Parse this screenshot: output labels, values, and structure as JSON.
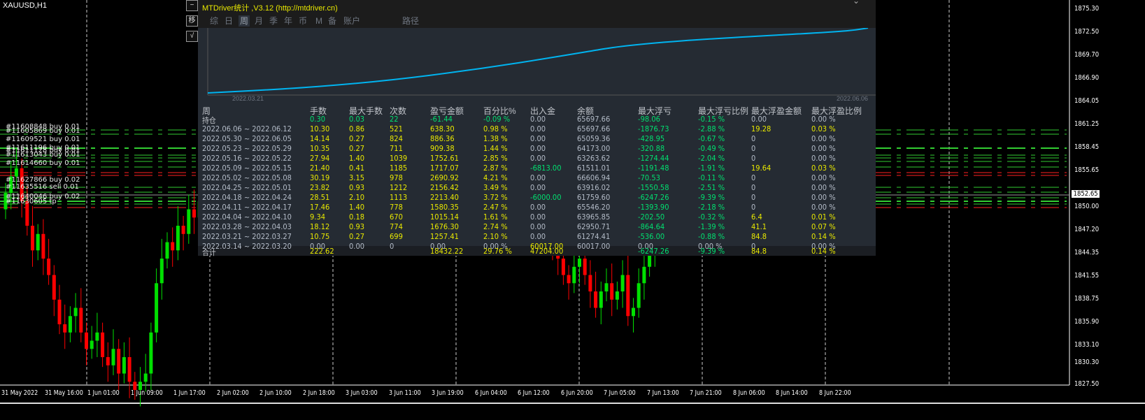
{
  "chart": {
    "symbol": "XAUUSD,H1",
    "current_price": "1852.65",
    "price_labels": [
      "1875.30",
      "1872.50",
      "1869.70",
      "1866.90",
      "1864.05",
      "1861.25",
      "1858.45",
      "1855.65",
      "1850.00",
      "1847.20",
      "1844.35",
      "1841.55",
      "1838.75",
      "1835.90",
      "1833.10",
      "1830.30",
      "1827.50"
    ],
    "time_labels": [
      "31 May 2022",
      "31 May 16:00",
      "1 Jun 01:00",
      "1 Jun 09:00",
      "1 Jun 17:00",
      "2 Jun 02:00",
      "2 Jun 10:00",
      "2 Jun 18:00",
      "3 Jun 03:00",
      "3 Jun 11:00",
      "3 Jun 19:00",
      "6 Jun 04:00",
      "6 Jun 12:00",
      "6 Jun 20:00",
      "7 Jun 05:00",
      "7 Jun 13:00",
      "7 Jun 21:00",
      "8 Jun 06:00",
      "8 Jun 14:00",
      "8 Jun 22:00"
    ],
    "order_labels": [
      "#11608848 buy 0.01",
      "#11605869 buy 0.01",
      "#11609521 buy 0.01",
      "#11611196 buy 0.01",
      "#11611128 buy 0.01",
      "#11613043 buy 0.01",
      "#11614660 buy 0.01",
      "#11627866 buy 0.02",
      "#11635516 sell 0.01",
      "#11640046 buy 0.02",
      "#11630605 tp"
    ],
    "candles_left": [
      1853,
      1855,
      1856,
      1852,
      1849,
      1846,
      1848,
      1845,
      1843,
      1840,
      1837,
      1836,
      1838,
      1839,
      1836,
      1834,
      1835,
      1836,
      1833,
      1832,
      1834,
      1831,
      1833,
      1830,
      1829,
      1830,
      1831,
      1836,
      1842,
      1845,
      1847,
      1846,
      1849,
      1848,
      1851,
      1850,
      1852
    ],
    "candles_mid": [
      1846,
      1845,
      1843,
      1842,
      1844,
      1845,
      1843,
      1841,
      1839,
      1841,
      1842,
      1840,
      1841,
      1843,
      1838,
      1839,
      1842,
      1844,
      1846,
      1848,
      1847
    ],
    "colors": {
      "up": "#00e000",
      "down": "#ff0000",
      "order_buy": "#32cd32",
      "order_sl": "#ff2020"
    }
  },
  "side_buttons": [
    "−",
    "移",
    "√"
  ],
  "panel": {
    "title": "MTDriver统计 ,V3.12 (http://mtdriver.cn)",
    "tabs": [
      "综",
      "日",
      "周",
      "月",
      "季",
      "年",
      "币",
      "M",
      "备",
      "账户",
      "路径"
    ],
    "active_tab": 2,
    "equity_start_date": "2022.03.21",
    "equity_end_date": "2022.06.06",
    "accent": "#00b4f0",
    "headers": [
      "周",
      "手数",
      "最大手数",
      "次数",
      "盈亏金额",
      "百分比%",
      "出入金",
      "余额",
      "最大浮亏",
      "最大浮亏比例",
      "最大浮盈金额",
      "最大浮盈比例"
    ],
    "position_row": [
      "持仓",
      "0.30",
      "0.03",
      "22",
      "-61.44",
      "-0.09 %",
      "0.00",
      "65697.66",
      "-98.06",
      "-0.15 %",
      "0.00",
      "0.00 %"
    ],
    "rows": [
      [
        "2022.06.06 ~ 2022.06.12",
        "10.30",
        "0.86",
        "521",
        "638.30",
        "0.98 %",
        "0.00",
        "65697.66",
        "-1876.73",
        "-2.88 %",
        "19.28",
        "0.03 %"
      ],
      [
        "2022.05.30 ~ 2022.06.05",
        "14.14",
        "0.27",
        "824",
        "886.36",
        "1.38 %",
        "0.00",
        "65059.36",
        "-428.95",
        "-0.67 %",
        "0",
        "0.00 %"
      ],
      [
        "2022.05.23 ~ 2022.05.29",
        "10.35",
        "0.27",
        "711",
        "909.38",
        "1.44 %",
        "0.00",
        "64173.00",
        "-320.88",
        "-0.49 %",
        "0",
        "0.00 %"
      ],
      [
        "2022.05.16 ~ 2022.05.22",
        "27.94",
        "1.40",
        "1039",
        "1752.61",
        "2.85 %",
        "0.00",
        "63263.62",
        "-1274.44",
        "-2.04 %",
        "0",
        "0.00 %"
      ],
      [
        "2022.05.09 ~ 2022.05.15",
        "21.40",
        "0.41",
        "1185",
        "1717.07",
        "2.87 %",
        "-6813.00",
        "61511.01",
        "-1191.48",
        "-1.91 %",
        "19.64",
        "0.03 %"
      ],
      [
        "2022.05.02 ~ 2022.05.08",
        "30.19",
        "3.15",
        "978",
        "2690.92",
        "4.21 %",
        "0.00",
        "66606.94",
        "-70.53",
        "-0.11 %",
        "0",
        "0.00 %"
      ],
      [
        "2022.04.25 ~ 2022.05.01",
        "23.82",
        "0.93",
        "1212",
        "2156.42",
        "3.49 %",
        "0.00",
        "63916.02",
        "-1550.58",
        "-2.51 %",
        "0",
        "0.00 %"
      ],
      [
        "2022.04.18 ~ 2022.04.24",
        "28.51",
        "2.10",
        "1113",
        "2213.40",
        "3.72 %",
        "-6000.00",
        "61759.60",
        "-6247.26",
        "-9.39 %",
        "0",
        "0.00 %"
      ],
      [
        "2022.04.11 ~ 2022.04.17",
        "17.46",
        "1.40",
        "778",
        "1580.35",
        "2.47 %",
        "0.00",
        "65546.20",
        "-1393.90",
        "-2.18 %",
        "0",
        "0.00 %"
      ],
      [
        "2022.04.04 ~ 2022.04.10",
        "9.34",
        "0.18",
        "670",
        "1015.14",
        "1.61 %",
        "0.00",
        "63965.85",
        "-202.50",
        "-0.32 %",
        "6.4",
        "0.01 %"
      ],
      [
        "2022.03.28 ~ 2022.04.03",
        "18.12",
        "0.93",
        "774",
        "1676.30",
        "2.74 %",
        "0.00",
        "62950.71",
        "-864.64",
        "-1.39 %",
        "41.1",
        "0.07 %"
      ],
      [
        "2022.03.21 ~ 2022.03.27",
        "10.75",
        "0.27",
        "699",
        "1257.41",
        "2.10 %",
        "0.00",
        "61274.41",
        "-536.00",
        "-0.88 %",
        "84.8",
        "0.14 %"
      ],
      [
        "2022.03.14 ~ 2022.03.20",
        "0.00",
        "0.00",
        "0",
        "0.00",
        "0.00 %",
        "60017.00",
        "60017.00",
        "0.00",
        "0.00 %",
        "0",
        "0.00 %"
      ]
    ],
    "total_row": [
      "合计",
      "222.62",
      "",
      "",
      "18432.22",
      "29.76 %",
      "47204.00",
      "",
      "-6247.26",
      "-9.39 %",
      "84.8",
      "0.14 %"
    ],
    "text_colors": {
      "gray": "#b4bcc8",
      "yellow": "#e8e800",
      "green": "#00e070"
    }
  }
}
